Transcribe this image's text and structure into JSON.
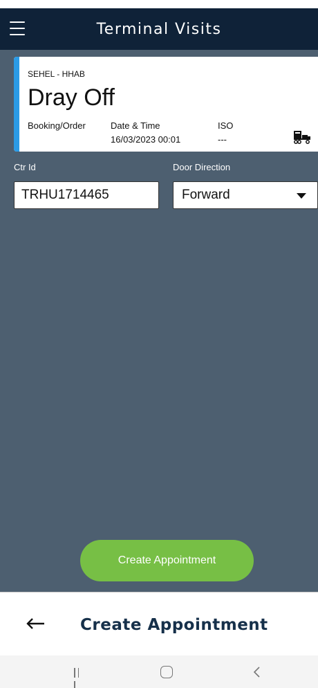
{
  "header": {
    "title": "Terminal Visits"
  },
  "visit_card": {
    "terminal": "SEHEL - HHAB",
    "type": "Dray Off",
    "booking_label": "Booking/Order",
    "booking_value": "",
    "datetime_label": "Date & Time",
    "datetime_value": "16/03/2023 00:01",
    "iso_label": "ISO",
    "iso_value": "---",
    "accent_color": "#2b9be6",
    "icon": "truck-icon"
  },
  "form": {
    "ctr_id_label": "Ctr Id",
    "ctr_id_value": "TRHU1714465",
    "door_direction_label": "Door Direction",
    "door_direction_value": "Forward"
  },
  "actions": {
    "create_button": "Create Appointment",
    "button_color": "#77bf45"
  },
  "footer": {
    "title": "Create Appointment"
  },
  "colors": {
    "header_bg": "#0f2238",
    "content_bg": "#4d5f70",
    "footer_title": "#16304a"
  }
}
